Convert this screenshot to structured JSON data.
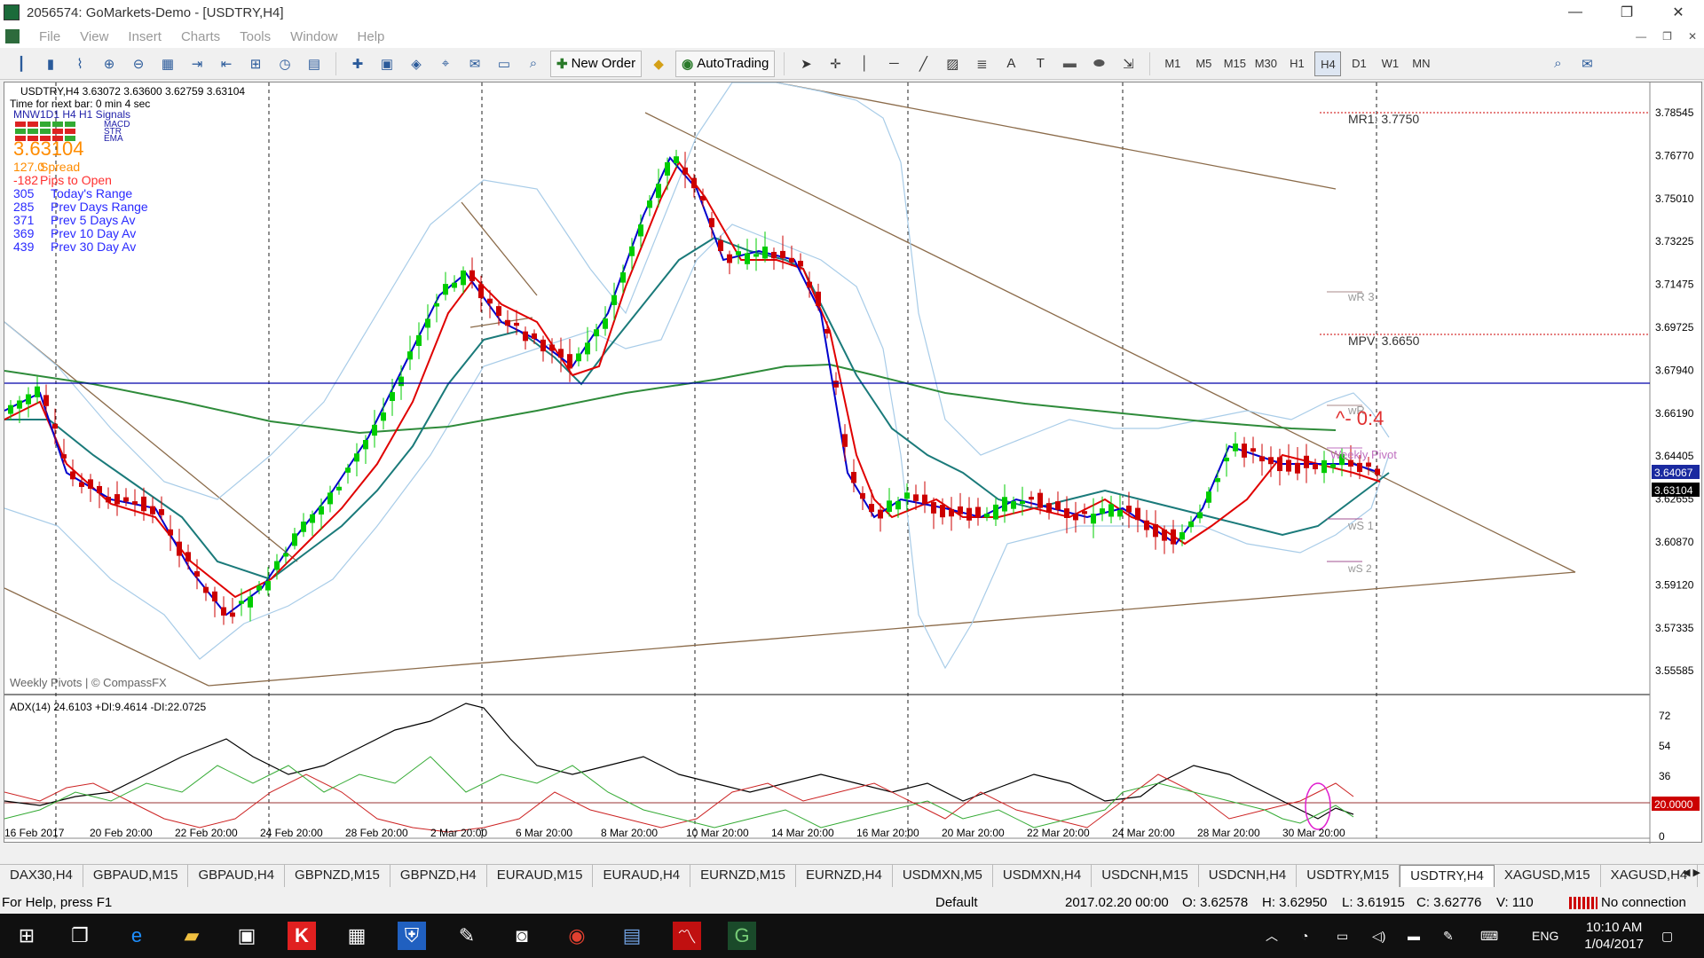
{
  "window": {
    "title": "2056574: GoMarkets-Demo - [USDTRY,H4]",
    "min": "—",
    "restore": "❐",
    "close": "✕"
  },
  "menu": [
    "File",
    "View",
    "Insert",
    "Charts",
    "Tools",
    "Window",
    "Help"
  ],
  "toolbar": {
    "new_order": "New Order",
    "autotrading": "AutoTrading",
    "timeframes": [
      "M1",
      "M5",
      "M15",
      "M30",
      "H1",
      "H4",
      "D1",
      "W1",
      "MN"
    ],
    "active_timeframe": "H4"
  },
  "chart": {
    "header": "USDTRY,H4  3.63072 3.63600 3.62759 3.63104",
    "next_bar": "Time for next bar: 0 min 4 sec",
    "signals_header": "MNW1D1 H4 H1  Signals",
    "signal_rows": [
      "MACD",
      "STR",
      "EMA"
    ],
    "big_price": "3.63104",
    "stats": [
      {
        "value": "127.0",
        "label": "Spread",
        "color": "#ff8c00"
      },
      {
        "value": "-182",
        "label": "Pips to Open",
        "color": "#ff3030"
      },
      {
        "value": "305",
        "label": "Today's Range",
        "color": "#2a2aff"
      },
      {
        "value": "285",
        "label": "Prev Days Range",
        "color": "#2a2aff"
      },
      {
        "value": "371",
        "label": "Prev 5 Days Av",
        "color": "#2a2aff"
      },
      {
        "value": "369",
        "label": "Prev 10 Day Av",
        "color": "#2a2aff"
      },
      {
        "value": "439",
        "label": "Prev 30 Day Av",
        "color": "#2a2aff"
      }
    ],
    "watermark": "Weekly Pivots | © CompassFX",
    "pivots": {
      "mr1": "MR1:  3.7750",
      "wr3": "wR 3",
      "mpv": "MPV:  3.6650",
      "wr": "wR",
      "weekly_pivot": "Weekly Pivot",
      "ws1": "wS 1",
      "ws2": "wS 2"
    },
    "countdown": "^- 0:4",
    "price_axis": [
      "3.78545",
      "3.76770",
      "3.75010",
      "3.73225",
      "3.71475",
      "3.69725",
      "3.67940",
      "3.66190",
      "3.64405",
      "3.62655",
      "3.60870",
      "3.59120",
      "3.57335",
      "3.55585"
    ],
    "price_marker_blue": "3.64067",
    "price_marker_black": "3.63104",
    "adx_label": "ADX(14) 24.6103 +DI:9.4614 -DI:22.0725",
    "adx_axis": [
      "72",
      "54",
      "36",
      "18",
      "0"
    ],
    "adx_level": "20.0000",
    "time_axis": [
      "16 Feb 2017",
      "20 Feb 20:00",
      "22 Feb 20:00",
      "24 Feb 20:00",
      "28 Feb 20:00",
      "2 Mar 20:00",
      "6 Mar 20:00",
      "8 Mar 20:00",
      "10 Mar 20:00",
      "14 Mar 20:00",
      "16 Mar 20:00",
      "20 Mar 20:00",
      "22 Mar 20:00",
      "24 Mar 20:00",
      "28 Mar 20:00",
      "30 Mar 20:00"
    ]
  },
  "tabs": [
    "DAX30,H4",
    "GBPAUD,M15",
    "GBPAUD,H4",
    "GBPNZD,M15",
    "GBPNZD,H4",
    "EURAUD,M15",
    "EURAUD,H4",
    "EURNZD,M15",
    "EURNZD,H4",
    "USDMXN,M5",
    "USDMXN,H4",
    "USDCNH,M15",
    "USDCNH,H4",
    "USDTRY,M15",
    "USDTRY,H4",
    "XAGUSD,M15",
    "XAGUSD,H4"
  ],
  "active_tab": "USDTRY,H4",
  "status": {
    "help": "For Help, press F1",
    "profile": "Default",
    "datetime": "2017.02.20 00:00",
    "open": "O: 3.62578",
    "high": "H: 3.62950",
    "low": "L: 3.61915",
    "close": "C: 3.62776",
    "volume": "V: 110",
    "connection": "No connection"
  },
  "taskbar": {
    "lang": "ENG",
    "time": "10:10 AM",
    "date": "1/04/2017"
  },
  "colors": {
    "bg": "#ffffff",
    "bull": "#00cc00",
    "bear": "#cc0000",
    "blue_line": "#0000cc",
    "red_line": "#e00000",
    "teal_line": "#1a7a7a",
    "green_ma": "#2e8b3a",
    "band": "#a8cce8",
    "trend": "#8b6b4a"
  }
}
